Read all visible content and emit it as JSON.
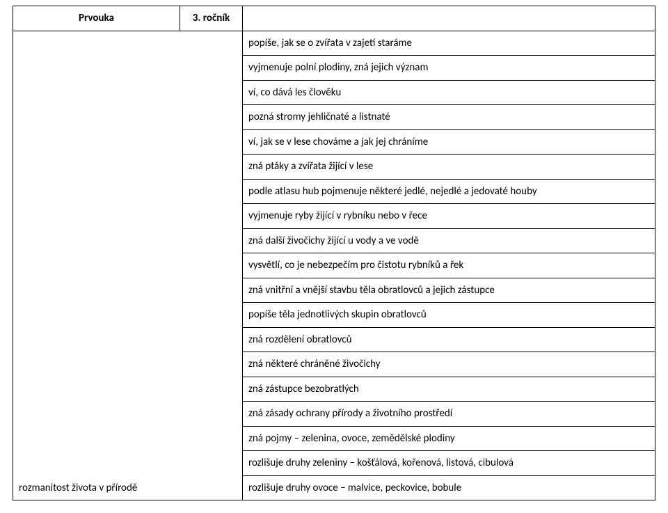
{
  "header": {
    "subject": "Prvouka",
    "grade": "3. ročník"
  },
  "topic": "rozmanitost života v přírodě",
  "rows": [
    "popíše, jak se o zvířata v zajetí staráme",
    "vyjmenuje polní plodiny, zná jejich význam",
    "ví, co dává les člověku",
    "pozná stromy jehličnaté a listnaté",
    "ví, jak se v lese chováme a jak jej chráníme",
    "zná ptáky a zvířata žijící v lese",
    "podle atlasu hub pojmenuje některé jedlé, nejedlé a jedovaté houby",
    "vyjmenuje ryby žijící v rybníku nebo v řece",
    "zná další živočichy žijící u vody a ve vodě",
    "vysvětlí, co je nebezpečím pro čistotu rybníků a řek",
    "zná vnitřní a vnější stavbu těla obratlovců a jejich zástupce",
    "popíše těla jednotlivých skupin obratlovců",
    "zná rozdělení obratlovců",
    "zná některé chráněné živočichy",
    "zná zástupce bezobratlých",
    "zná zásady ochrany přírody a životního prostředí",
    "zná pojmy – zelenina, ovoce, zemědělské plodiny",
    "rozlišuje druhy zeleniny – košťálová, kořenová, listová, cibulová",
    "rozlišuje druhy ovoce – malvice, peckovice, bobule"
  ]
}
